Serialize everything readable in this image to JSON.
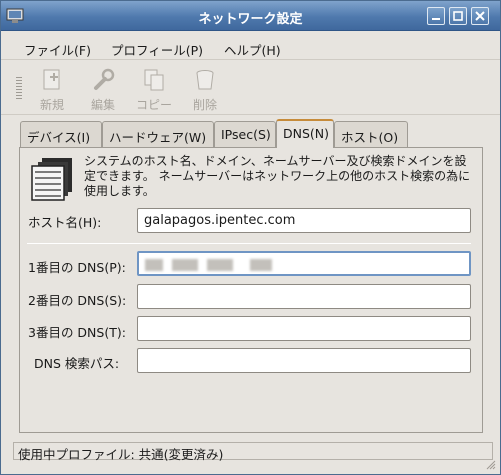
{
  "window": {
    "title": "ネットワーク設定"
  },
  "menu": {
    "file": "ファイル(F)",
    "profile": "プロフィール(P)",
    "help": "ヘルプ(H)"
  },
  "toolbar": {
    "new_label": "新規",
    "edit_label": "編集",
    "copy_label": "コピー",
    "delete_label": "削除"
  },
  "tabs": [
    {
      "label": "デバイス(I)"
    },
    {
      "label": "ハードウェア(W)"
    },
    {
      "label": "IPsec(S)"
    },
    {
      "label": "DNS(N)",
      "active": true
    },
    {
      "label": "ホスト(O)"
    }
  ],
  "dns_panel": {
    "description": "システムのホスト名、ドメイン、ネームサーバー及び検索ドメインを設定できます。 ネームサーバーはネットワーク上の他のホスト検索の為に使用します。",
    "hostname_label": "ホスト名(H):",
    "hostname_value": "galapagos.ipentec.com",
    "dns1_label": "1番目の DNS(P):",
    "dns1_value": "",
    "dns2_label": "2番目の DNS(S):",
    "dns2_value": "",
    "dns3_label": "3番目の DNS(T):",
    "dns3_value": "",
    "search_label": "DNS 検索パス:",
    "search_value": ""
  },
  "statusbar": {
    "text": "使用中プロファイル: 共通(変更済み)"
  },
  "colors": {
    "titlebar": "#4f79ad",
    "active_tab_accent": "#c68b3a",
    "window_bg": "#e7e4df"
  }
}
